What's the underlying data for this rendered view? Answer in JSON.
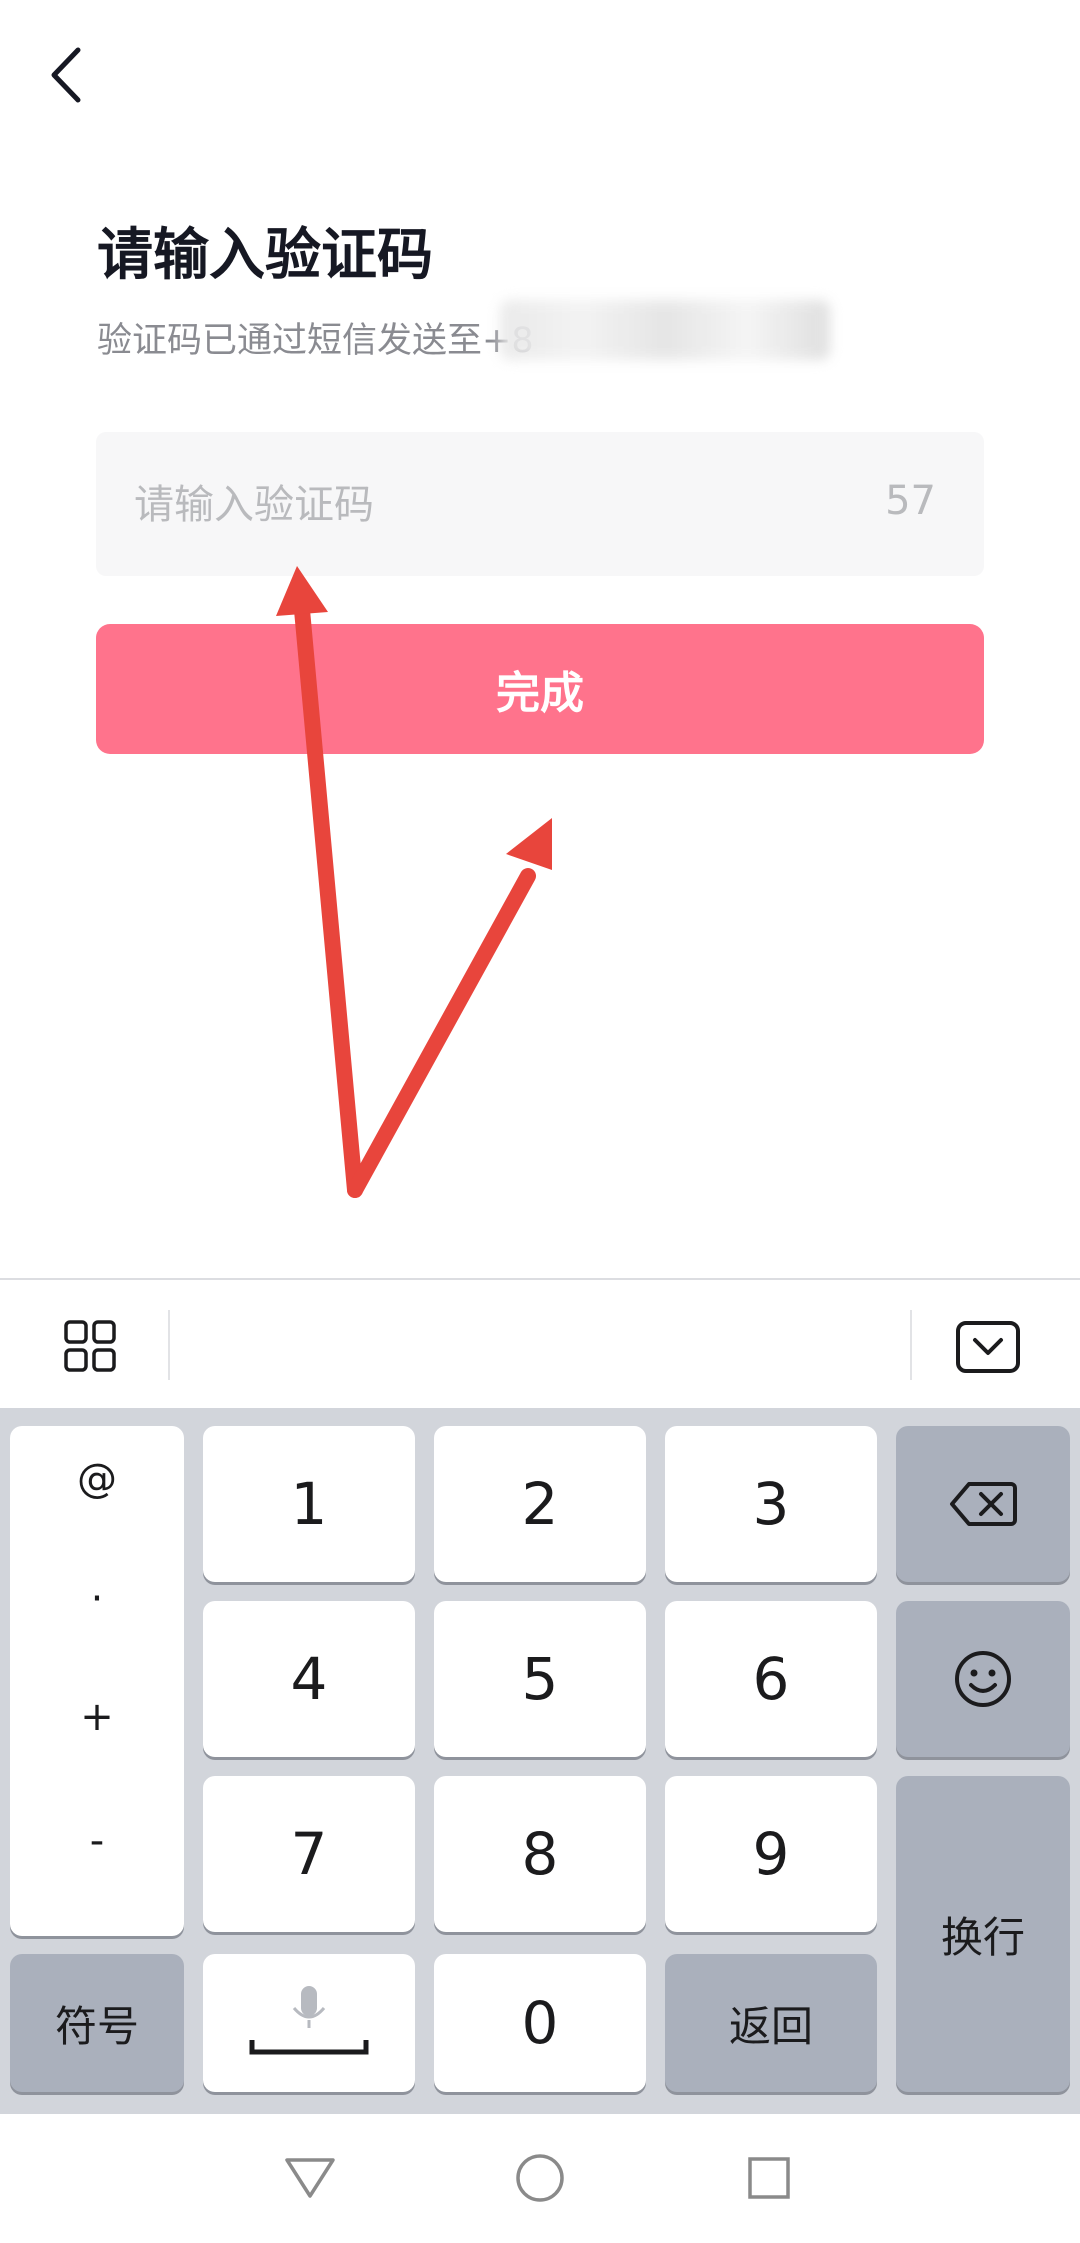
{
  "header": {
    "back_label": "back"
  },
  "page": {
    "title": "请输入验证码",
    "subtitle": "验证码已通过短信发送至+8"
  },
  "form": {
    "code_placeholder": "请输入验证码",
    "countdown": "57",
    "done_label": "完成"
  },
  "keyboard": {
    "symbols": [
      "@",
      "·",
      "+",
      "-"
    ],
    "digits": [
      "1",
      "2",
      "3",
      "4",
      "5",
      "6",
      "7",
      "8",
      "9",
      "0"
    ],
    "symbol_key": "符号",
    "return_key": "返回",
    "newline_key": "换行"
  },
  "colors": {
    "accent": "#ff738c",
    "annotation_arrow": "#e8453c",
    "keyboard_bg": "#d2d5db"
  }
}
